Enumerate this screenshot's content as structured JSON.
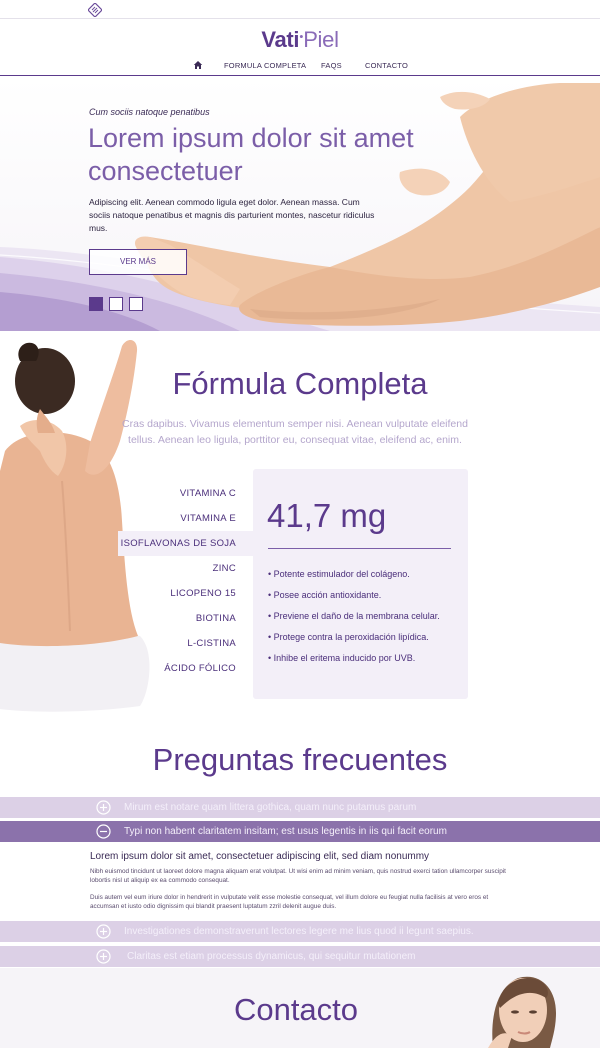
{
  "header": {
    "brand_part1": "Vati",
    "brand_part2": "Piel",
    "nav": [
      {
        "label": "FORMULA COMPLETA"
      },
      {
        "label": "FAQS"
      },
      {
        "label": "CONTACTO"
      }
    ]
  },
  "hero": {
    "kicker": "Cum sociis natoque penatibus",
    "title": "Lorem ipsum dolor sit amet consectetuer",
    "description": "Adipiscing elit. Aenean commodo ligula eget dolor. Aenean massa. Cum sociis natoque penatibus et magnis dis parturient montes, nascetur ridiculus mus.",
    "button_label": "VER MÁS",
    "slides_total": 3,
    "active_slide": 1
  },
  "formula": {
    "title": "Fórmula Completa",
    "subtitle": "Cras dapibus. Vivamus elementum semper nisi. Aenean vulputate eleifend tellus. Aenean leo ligula, porttitor eu, consequat vitae, eleifend ac, enim.",
    "items": [
      {
        "label": "VITAMINA C"
      },
      {
        "label": "VITAMINA E"
      },
      {
        "label": "ISOFLAVONAS DE SOJA"
      },
      {
        "label": "ZINC"
      },
      {
        "label": "LICOPENO 15"
      },
      {
        "label": "BIOTINA"
      },
      {
        "label": "L-CISTINA"
      },
      {
        "label": "ÁCIDO FÓLICO"
      }
    ],
    "active_index": 2,
    "amount": "41,7 mg",
    "benefits": [
      "• Potente estimulador del colágeno.",
      "• Posee acción antioxidante.",
      "• Previene el daño de la membrana celular.",
      "• Protege contra la peroxidación lipídica.",
      "• Inhibe el eritema inducido por UVB."
    ]
  },
  "faq": {
    "title": "Preguntas frecuentes",
    "questions": [
      {
        "label": "Mirum est notare quam littera gothica, quam nunc putamus parum",
        "open": false
      },
      {
        "label": "Typi non habent claritatem insitam; est usus legentis in iis qui facit eorum",
        "open": true
      },
      {
        "label": "Investigationes demonstraverunt lectores legere me lius quod ii legunt saepius.",
        "open": false
      },
      {
        "label": "Claritas est etiam processus dynamicus, qui sequitur mutationem",
        "open": false
      }
    ],
    "answer_lead": "Lorem ipsum dolor sit amet, consectetuer adipiscing elit, sed diam nonummy",
    "answer_p1": "Nibh euismod tincidunt ut laoreet dolore magna aliquam erat volutpat. Ut wisi enim ad minim veniam, quis nostrud exerci tation ullamcorper suscipit lobortis nisl ut aliquip ex ea commodo consequat.",
    "answer_p2": "Duis autem vel eum iriure dolor in hendrerit in vulputate velit esse molestie consequat, vel illum dolore eu feugiat nulla facilisis at vero eros et accumsan et iusto odio dignissim qui blandit praesent luptatum zzril delenit augue duis."
  },
  "contact": {
    "title": "Contacto"
  },
  "colors": {
    "brand": "#5b3a8c",
    "accent_light": "#f3eff8",
    "faq_bar": "#dcd0e6",
    "faq_bar_open": "#8b72ab"
  },
  "icons": [
    "brand-mark-icon",
    "home-icon",
    "plus-circle-icon",
    "minus-circle-icon"
  ]
}
